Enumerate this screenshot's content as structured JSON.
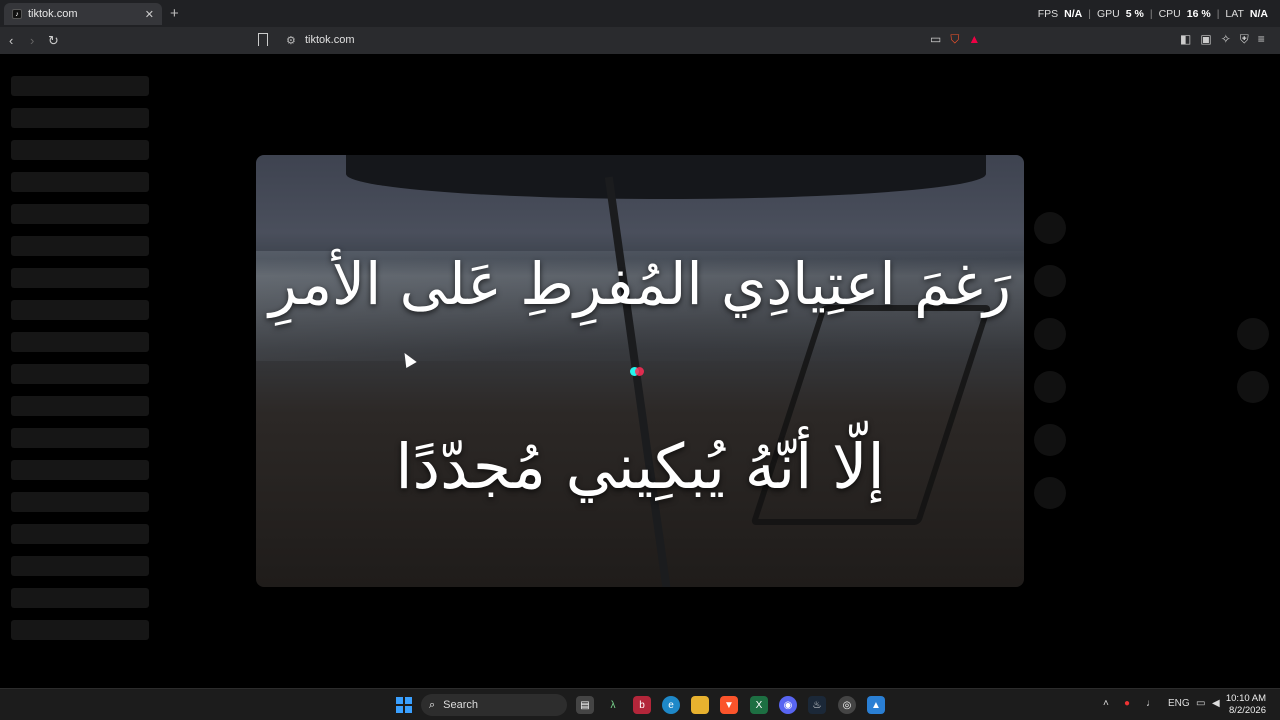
{
  "browser": {
    "tab": {
      "title": "tiktok.com",
      "favicon": "tiktok-icon",
      "close_icon": "close-icon"
    },
    "new_tab_label": "+",
    "perf_overlay": {
      "fps_label": "FPS",
      "fps_value": "N/A",
      "gpu_label": "GPU",
      "gpu_value": "5 %",
      "cpu_label": "CPU",
      "cpu_value": "16 %",
      "lat_label": "LAT",
      "lat_value": "N/A"
    },
    "url": "tiktok.com"
  },
  "video": {
    "caption_line1": "رَغمَ اعتِيادِي المُفرِطِ عَلى الأمرِ",
    "caption_line2": "إلّا أنّهُ يُبكِيني مُجدّدًا"
  },
  "taskbar": {
    "search_placeholder": "Search",
    "language": "ENG",
    "time": "10:10 AM",
    "date": "8/2/2026",
    "apps": [
      "file-explorer-icon",
      "terminal-icon",
      "app-icon",
      "edge-icon",
      "folder-icon",
      "brave-icon",
      "excel-icon",
      "discord-icon",
      "steam-icon",
      "chrome-icon",
      "photos-icon"
    ]
  }
}
